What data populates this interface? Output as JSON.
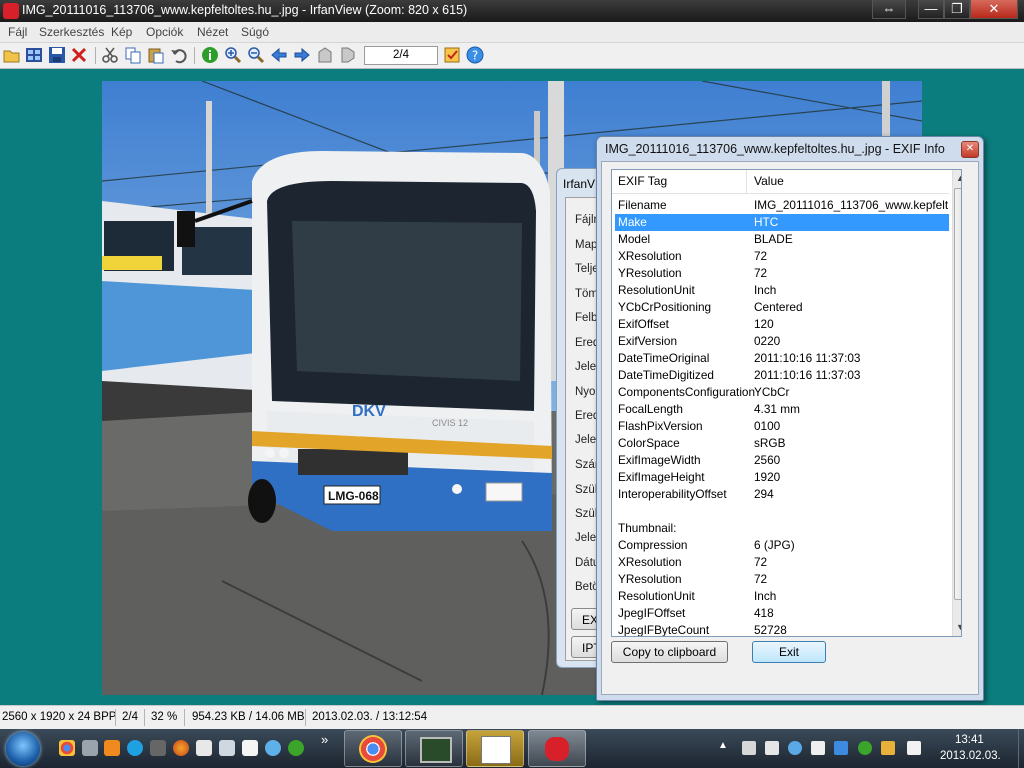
{
  "window": {
    "title": "IMG_20111016_113706_www.kepfeltoltes.hu_.jpg - IrfanView (Zoom: 820 x 615)",
    "controls": {
      "resize": "⇔",
      "minimize": "—",
      "maximize": "❐",
      "close": "✕"
    }
  },
  "menu": [
    "Fájl",
    "Szerkesztés",
    "Kép",
    "Opciók",
    "Nézet",
    "Súgó"
  ],
  "toolbar": {
    "icons": [
      "open-folder-icon",
      "thumbnails-icon",
      "save-icon",
      "delete-icon",
      "cut-icon",
      "copy-icon",
      "paste-icon",
      "undo-icon",
      "info-icon",
      "zoom-in-icon",
      "zoom-out-icon",
      "prev-arrow-icon",
      "next-arrow-icon",
      "first-image-icon",
      "last-image-icon",
      "settings-icon",
      "help-icon"
    ],
    "page_indicator": "2/4"
  },
  "photo": {
    "bus_plate": "LMG-068",
    "bus_brand": "DKV",
    "bus_model": "CIVIS 12",
    "colors": {
      "sky": "#3f7fd1",
      "bus_white": "#e9ecef",
      "bus_blue": "#2f6fc4",
      "tram_blue": "#4f96d8",
      "asphalt": "#5d5d5b"
    }
  },
  "props_dialog": {
    "title": "IrfanV",
    "labels": [
      "Fájln",
      "Map",
      "Telje",
      "Töm",
      "Felbo",
      "Ered",
      "Jelen",
      "Nyon",
      "Ered",
      "Jelen",
      "Szán",
      "Szük",
      "Szük",
      "Jelen",
      "Dátu",
      "Betö"
    ],
    "buttons": [
      "EXI",
      "IPT"
    ]
  },
  "exif": {
    "title": "IMG_20111016_113706_www.kepfeltoltes.hu_.jpg - EXIF Info",
    "headers": {
      "tag": "EXIF Tag",
      "value": "Value"
    },
    "rows": [
      {
        "tag": "Filename",
        "value": "IMG_20111016_113706_www.kepfelt..."
      },
      {
        "tag": "Make",
        "value": "HTC",
        "selected": true
      },
      {
        "tag": "Model",
        "value": "BLADE"
      },
      {
        "tag": "XResolution",
        "value": "72"
      },
      {
        "tag": "YResolution",
        "value": "72"
      },
      {
        "tag": "ResolutionUnit",
        "value": "Inch"
      },
      {
        "tag": "YCbCrPositioning",
        "value": "Centered"
      },
      {
        "tag": "ExifOffset",
        "value": "120"
      },
      {
        "tag": "ExifVersion",
        "value": "0220"
      },
      {
        "tag": "DateTimeOriginal",
        "value": "2011:10:16 11:37:03"
      },
      {
        "tag": "DateTimeDigitized",
        "value": "2011:10:16 11:37:03"
      },
      {
        "tag": "ComponentsConfiguration",
        "value": "YCbCr"
      },
      {
        "tag": "FocalLength",
        "value": "4.31 mm"
      },
      {
        "tag": "FlashPixVersion",
        "value": "0100"
      },
      {
        "tag": "ColorSpace",
        "value": "sRGB"
      },
      {
        "tag": "ExifImageWidth",
        "value": "2560"
      },
      {
        "tag": "ExifImageHeight",
        "value": "1920"
      },
      {
        "tag": "InteroperabilityOffset",
        "value": "294"
      },
      {
        "tag": "",
        "value": ""
      },
      {
        "tag": "Thumbnail:",
        "value": ""
      },
      {
        "tag": "Compression",
        "value": "6 (JPG)"
      },
      {
        "tag": "XResolution",
        "value": "72"
      },
      {
        "tag": "YResolution",
        "value": "72"
      },
      {
        "tag": "ResolutionUnit",
        "value": "Inch"
      },
      {
        "tag": "JpegIFOffset",
        "value": "418"
      },
      {
        "tag": "JpegIFByteCount",
        "value": "52728"
      }
    ],
    "copy_button": "Copy to clipboard",
    "exit_button": "Exit",
    "selection_color": "#3399ff"
  },
  "status": {
    "dimensions": "2560 x 1920 x 24 BPP",
    "index": "2/4",
    "zoom": "32 %",
    "size": "954.23 KB / 14.06 MB",
    "datetime": "2013.02.03. / 13:12:54"
  },
  "taskbar": {
    "quick_launch": [
      "chrome-icon",
      "settings-icon",
      "vlc-icon",
      "skype-icon",
      "tool-icon",
      "firefox-icon",
      "document-icon",
      "task-icon",
      "calendar-icon",
      "network-icon",
      "utorrent-icon"
    ],
    "overflow": "»",
    "windows": [
      "chrome-window",
      "screen-window",
      "calendar-window",
      "irfanview-window"
    ],
    "tray": [
      "up-arrow-icon",
      "phone-icon",
      "media-icon",
      "power-icon",
      "monitor-icon",
      "dropbox-icon",
      "utorrent-icon",
      "network-icon",
      "flag-icon"
    ],
    "clock_time": "13:41",
    "clock_date": "2013.02.03."
  }
}
